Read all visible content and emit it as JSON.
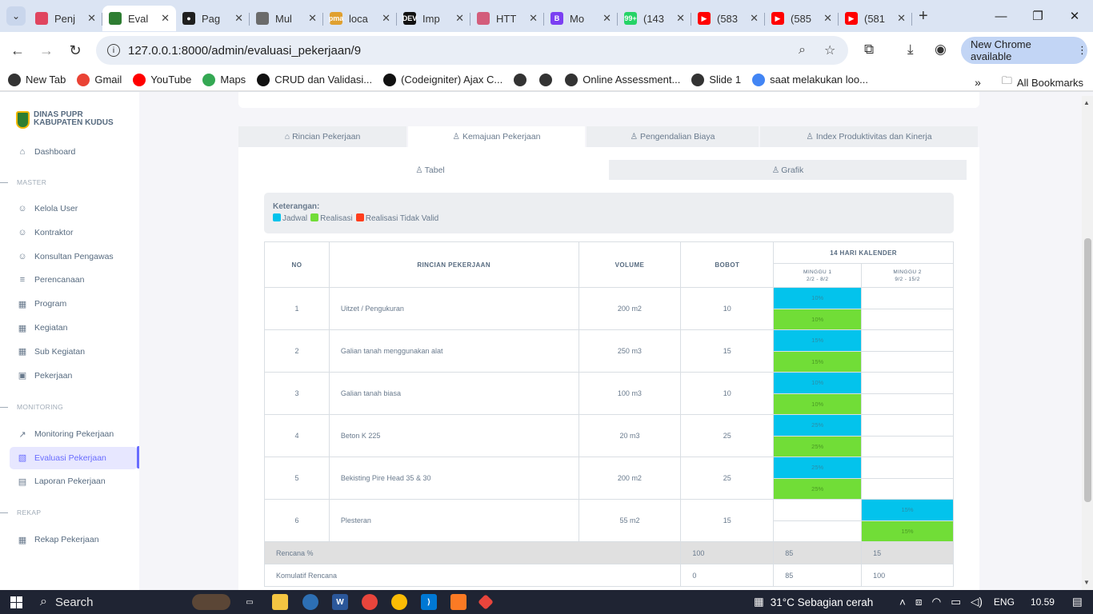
{
  "browser": {
    "tabs": [
      {
        "title": "Penj",
        "fav_color": "#e0455f",
        "fav_text": ""
      },
      {
        "title": "Eval",
        "fav_color": "#2e7d32",
        "fav_text": "",
        "active": true
      },
      {
        "title": "Pag",
        "fav_color": "#1f1f1f",
        "fav_text": "●"
      },
      {
        "title": "Mul",
        "fav_color": "#6b6b6b",
        "fav_text": ""
      },
      {
        "title": "loca",
        "fav_color": "#e0a030",
        "fav_text": "pma"
      },
      {
        "title": "Imp",
        "fav_color": "#111111",
        "fav_text": "DEV"
      },
      {
        "title": "HTT",
        "fav_color": "#d35d7b",
        "fav_text": ""
      },
      {
        "title": "Mo",
        "fav_color": "#7b3ff2",
        "fav_text": "B"
      },
      {
        "title": "(143",
        "fav_color": "#25d366",
        "fav_text": "99+"
      },
      {
        "title": "(583",
        "fav_color": "#ff0000",
        "fav_text": "▶"
      },
      {
        "title": "(585",
        "fav_color": "#ff0000",
        "fav_text": "▶"
      },
      {
        "title": "(581",
        "fav_color": "#ff0000",
        "fav_text": "▶"
      }
    ],
    "url": "127.0.0.1:8000/admin/evaluasi_pekerjaan/9",
    "chrome_available": "New Chrome available",
    "bookmarks": [
      {
        "label": "New Tab",
        "color": "#333333"
      },
      {
        "label": "Gmail",
        "color": "#ea4335"
      },
      {
        "label": "YouTube",
        "color": "#ff0000"
      },
      {
        "label": "Maps",
        "color": "#34a853"
      },
      {
        "label": "CRUD dan Validasi...",
        "color": "#111111"
      },
      {
        "label": "(Codeigniter) Ajax C...",
        "color": "#111111"
      },
      {
        "label": "",
        "color": "#333333"
      },
      {
        "label": "",
        "color": "#333333"
      },
      {
        "label": "Online Assessment...",
        "color": "#333333"
      },
      {
        "label": "Slide 1",
        "color": "#333333"
      },
      {
        "label": "saat melakukan loo...",
        "color": "#4285f4"
      }
    ],
    "all_bookmarks": "All Bookmarks"
  },
  "sidebar": {
    "brand_line1": "DINAS PUPR",
    "brand_line2": "KABUPATEN KUDUS",
    "dashboard": "Dashboard",
    "header_master": "MASTER",
    "master_items": [
      "Kelola User",
      "Kontraktor",
      "Konsultan Pengawas",
      "Perencanaan",
      "Program",
      "Kegiatan",
      "Sub Kegiatan",
      "Pekerjaan"
    ],
    "header_monitoring": "MONITORING",
    "monitoring_items": [
      "Monitoring Pekerjaan",
      "Evaluasi Pekerjaan",
      "Laporan Pekerjaan"
    ],
    "header_rekap": "REKAP",
    "rekap_items": [
      "Rekap Pekerjaan"
    ]
  },
  "main_tabs": [
    "Rincian Pekerjaan",
    "Kemajuan Pekerjaan",
    "Pengendalian Biaya",
    "Index Produktivitas dan Kinerja"
  ],
  "sub_tabs": [
    "Tabel",
    "Grafik"
  ],
  "legend": {
    "title": "Keterangan:",
    "items": [
      {
        "label": "Jadwal",
        "color": "#03c3ec"
      },
      {
        "label": "Realisasi",
        "color": "#71dd37"
      },
      {
        "label": "Realisasi Tidak Valid",
        "color": "#ff3e1d"
      }
    ]
  },
  "table": {
    "headers": {
      "no": "NO",
      "rincian": "RINCIAN PEKERJAAN",
      "volume": "VOLUME",
      "bobot": "BOBOT",
      "kalender": "14 HARI KALENDER",
      "minggu1": "MINGGU 1",
      "minggu1_range": "2/2 - 8/2",
      "minggu2": "MINGGU 2",
      "minggu2_range": "9/2 - 15/2"
    },
    "rows": [
      {
        "no": "1",
        "rincian": "Uitzet / Pengukuran",
        "volume": "200 m2",
        "bobot": "10",
        "week": 1,
        "jadwal": "10%",
        "realisasi": "10%"
      },
      {
        "no": "2",
        "rincian": "Galian tanah menggunakan alat",
        "volume": "250 m3",
        "bobot": "15",
        "week": 1,
        "jadwal": "15%",
        "realisasi": "15%"
      },
      {
        "no": "3",
        "rincian": "Galian tanah biasa",
        "volume": "100 m3",
        "bobot": "10",
        "week": 1,
        "jadwal": "10%",
        "realisasi": "10%"
      },
      {
        "no": "4",
        "rincian": "Beton K 225",
        "volume": "20 m3",
        "bobot": "25",
        "week": 1,
        "jadwal": "25%",
        "realisasi": "25%"
      },
      {
        "no": "5",
        "rincian": "Bekisting Pire Head 35 & 30",
        "volume": "200 m2",
        "bobot": "25",
        "week": 1,
        "jadwal": "25%",
        "realisasi": "25%"
      },
      {
        "no": "6",
        "rincian": "Plesteran",
        "volume": "55 m2",
        "bobot": "15",
        "week": 2,
        "jadwal": "15%",
        "realisasi": "15%"
      }
    ],
    "rencana": {
      "label": "Rencana %",
      "bobot": "100",
      "m1": "85",
      "m2": "15"
    },
    "kumulatif": {
      "label": "Komulatif Rencana",
      "bobot": "0",
      "m1": "85",
      "m2": "100"
    }
  },
  "taskbar": {
    "search": "Search",
    "weather": "31°C  Sebagian cerah",
    "lang": "ENG",
    "time": "10.59"
  }
}
